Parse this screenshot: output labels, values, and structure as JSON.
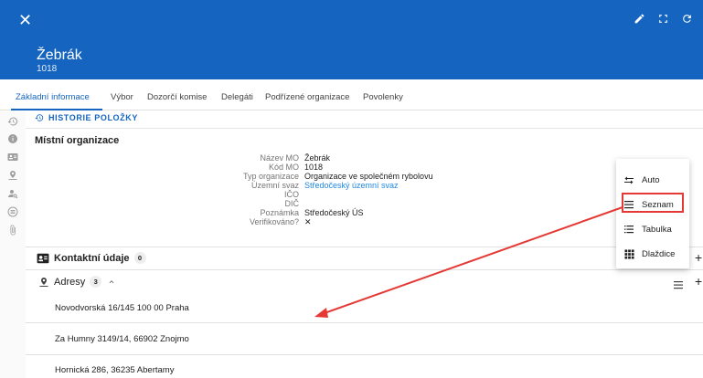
{
  "header": {
    "close_label": "✕",
    "title": "Žebrák",
    "subtitle": "1018"
  },
  "tabs": [
    {
      "label": "Základní informace",
      "active": true
    },
    {
      "label": "Výbor"
    },
    {
      "label": "Dozorčí komise"
    },
    {
      "label": "Delegáti"
    },
    {
      "label": "Podřízené organizace"
    },
    {
      "label": "Povolenky"
    }
  ],
  "history": {
    "label": "HISTORIE POLOŽKY"
  },
  "section": {
    "title": "Místní organizace",
    "fields": [
      {
        "key": "Název MO",
        "value": "Žebrák"
      },
      {
        "key": "Kód MO",
        "value": "1018"
      },
      {
        "key": "Typ organizace",
        "value": "Organizace ve společném rybolovu"
      },
      {
        "key": "Územní svaz",
        "value": "Středočeský územní svaz",
        "link": true
      },
      {
        "key": "IČO",
        "value": ""
      },
      {
        "key": "DIČ",
        "value": ""
      },
      {
        "key": "Poznámka",
        "value": "Středočeský ÚS"
      },
      {
        "key": "Verifikováno?",
        "value": "✕"
      }
    ]
  },
  "contacts": {
    "title": "Kontaktní údaje",
    "count": "0"
  },
  "addresses": {
    "title": "Adresy",
    "count": "3",
    "items": [
      "Novodvorská 16/145 100 00 Praha",
      "Za Humny 3149/14, 66902 Znojmo",
      "Hornická 286, 36235 Abertamy"
    ]
  },
  "menu": {
    "items": [
      {
        "label": "Auto",
        "icon": "swap-icon"
      },
      {
        "label": "Seznam",
        "icon": "list-icon"
      },
      {
        "label": "Tabulka",
        "icon": "table-list-icon"
      },
      {
        "label": "Dlaždice",
        "icon": "grid-icon"
      }
    ],
    "highlighted": "Seznam"
  },
  "colors": {
    "header": "#1565c0",
    "accent": "#1565c0",
    "link": "#1e88e5",
    "annotation": "#e53935"
  }
}
